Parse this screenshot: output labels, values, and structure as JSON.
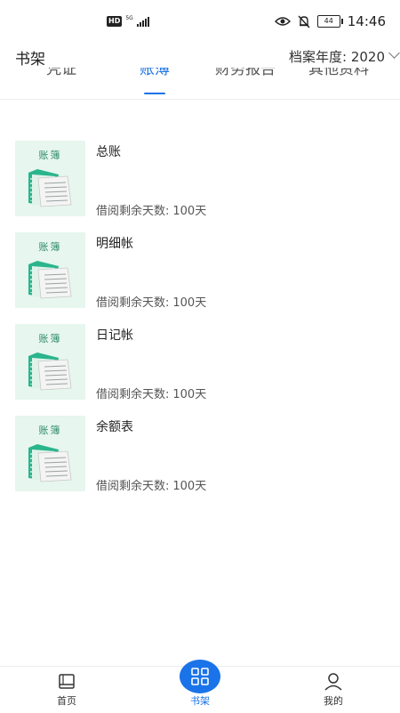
{
  "status_bar": {
    "network_badge": "HD",
    "network_type": "5G",
    "battery": "44",
    "time": "14:46",
    "icons": [
      "eye-icon",
      "mute-bell-icon",
      "battery-icon",
      "signal-icon"
    ]
  },
  "header": {
    "title": "书架",
    "year_label": "档案年度: 2020"
  },
  "tabs": [
    {
      "label": "凭证",
      "active": false
    },
    {
      "label": "账薄",
      "active": true
    },
    {
      "label": "财务报告",
      "active": false
    },
    {
      "label": "其他资料",
      "active": false
    }
  ],
  "cover_label": "账簿",
  "remaining_label": "借阅剩余天数:",
  "books": [
    {
      "name": "总账",
      "remaining": "100天"
    },
    {
      "name": "明细帐",
      "remaining": "100天"
    },
    {
      "name": "日记帐",
      "remaining": "100天"
    },
    {
      "name": "余额表",
      "remaining": "100天"
    }
  ],
  "bottom_nav": [
    {
      "label": "首页",
      "icon": "book-icon",
      "active": false
    },
    {
      "label": "书架",
      "icon": "grid-icon",
      "active": true
    },
    {
      "label": "我的",
      "icon": "user-icon",
      "active": false
    }
  ],
  "colors": {
    "accent": "#1a73e8",
    "cover_bg": "#e7f6ee",
    "cover_spine": "#2bb58c"
  }
}
